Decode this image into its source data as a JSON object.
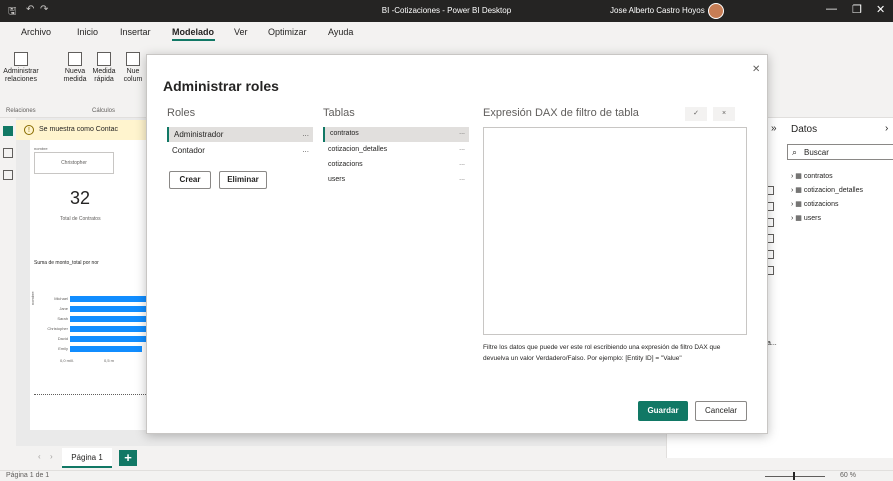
{
  "window": {
    "title": "BI -Cotizaciones - Power BI Desktop",
    "user": "Jose Alberto Castro Hoyos",
    "minimize": "—",
    "restore": "❐",
    "close": "✕"
  },
  "menu": {
    "items": [
      "Archivo",
      "Inicio",
      "Insertar",
      "Modelado",
      "Ver",
      "Optimizar",
      "Ayuda"
    ],
    "active": "Modelado"
  },
  "ribbon": {
    "manage_relations": "Administrar relaciones",
    "new_measure": "Nueva medida",
    "quick_measure": "Medida rápida",
    "new_column": "Nue colum",
    "group_relations": "Relaciones",
    "group_calcs": "Cálculos"
  },
  "banner": {
    "text": "Se muestra como Contac"
  },
  "report": {
    "filter_label": "nombre",
    "filter_value": "Christopher",
    "kpi_value": "32",
    "kpi_label": "Total de Contratos",
    "chart_title": "Suma de monto_total por nor",
    "y_axis_label": "nombre",
    "x_ticks": [
      "0,0 mill.",
      "0,5 m"
    ]
  },
  "chart_data": {
    "type": "bar",
    "title": "Suma de monto_total por nor",
    "ylabel": "nombre",
    "categories": [
      "Michael",
      "Jane",
      "Sarah",
      "Christopher",
      "David",
      "Emily"
    ],
    "values": [
      0.6,
      0.6,
      0.6,
      0.6,
      0.6,
      0.55
    ]
  },
  "right_panel": {
    "title": "Datos",
    "search_placeholder": "Buscar",
    "tables": [
      "contratos",
      "cotizacion_detalles",
      "cotizacions",
      "users"
    ],
    "partial_label": "a..."
  },
  "pages": {
    "tab": "Página 1",
    "add": "+"
  },
  "status": {
    "page_info": "Página 1 de 1",
    "zoom": "60 %"
  },
  "modal": {
    "title": "Administrar roles",
    "roles_header": "Roles",
    "tables_header": "Tablas",
    "dax_header": "Expresión DAX de filtro de tabla",
    "roles": [
      {
        "name": "Administrador",
        "selected": true
      },
      {
        "name": "Contador",
        "selected": false
      }
    ],
    "tables": [
      {
        "name": "contratos",
        "selected": true
      },
      {
        "name": "cotizacion_detalles",
        "selected": false
      },
      {
        "name": "cotizacions",
        "selected": false
      },
      {
        "name": "users",
        "selected": false
      }
    ],
    "create_button": "Crear",
    "delete_button": "Eliminar",
    "more": "...",
    "dax_check": "✓",
    "dax_cancel": "×",
    "help_text": "Filtre los datos que puede ver este rol escribiendo una expresión de filtro DAX que devuelva un valor Verdadero/Falso. Por ejemplo: [Entity ID] = \"Value\"",
    "save_button": "Guardar",
    "cancel_button": "Cancelar",
    "close": "✕"
  },
  "colors": {
    "accent": "#117865",
    "bar": "#118dff",
    "titlebar": "#252423"
  }
}
